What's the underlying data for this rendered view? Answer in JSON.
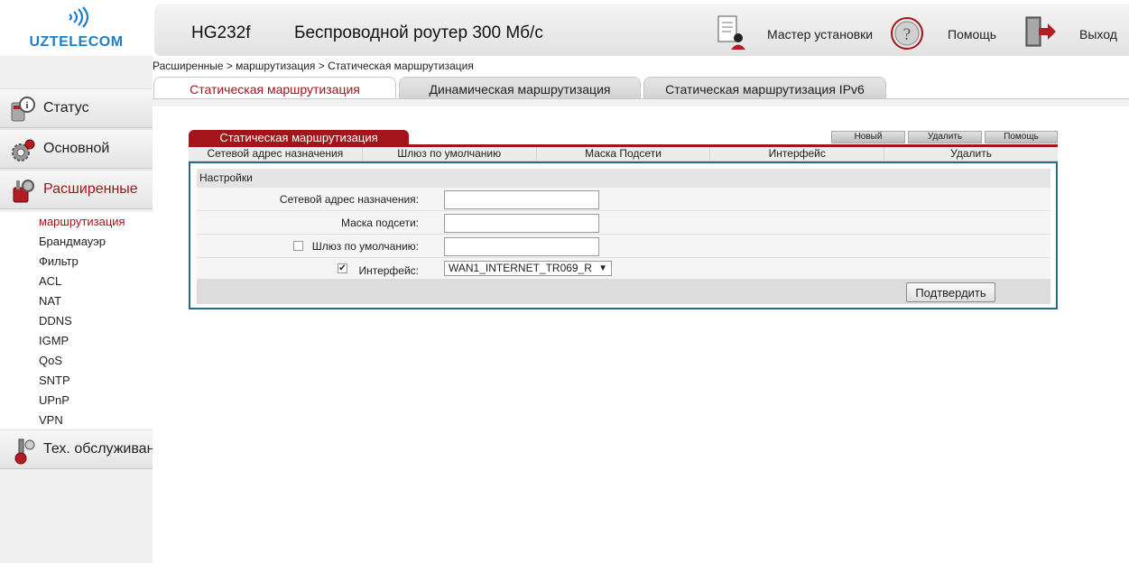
{
  "brand": {
    "logo_text": "UZTELECOM"
  },
  "header": {
    "model": "HG232f",
    "product": "Беспроводной роутер 300 Мб/с",
    "wizard_label": "Мастер установки",
    "help_label": "Помощь",
    "logout_label": "Выход"
  },
  "sidebar": {
    "status_label": "Статус",
    "basic_label": "Основной",
    "advanced_label": "Расширенные",
    "maintenance_label": "Тех. обслуживан",
    "subitems": [
      "маршрутизация",
      "Брандмауэр",
      "Фильтр",
      "ACL",
      "NAT",
      "DDNS",
      "IGMP",
      "QoS",
      "SNTP",
      "UPnP",
      "VPN"
    ]
  },
  "breadcrumb": "Расширенные > маршрутизация > Статическая маршрутизация",
  "tabs": [
    "Статическая маршрутизация",
    "Динамическая маршрутизация",
    "Статическая маршрутизация IPv6"
  ],
  "table": {
    "title": "Статическая маршрутизация",
    "buttons": {
      "new": "Новый",
      "delete": "Удалить",
      "help": "Помощь"
    },
    "columns": [
      "Сетевой адрес назначения",
      "Шлюз по умолчанию",
      "Маска Подсети",
      "Интерфейс",
      "Удалить"
    ]
  },
  "form": {
    "section_title": "Настройки",
    "dest_label": "Сетевой адрес назначения:",
    "dest_value": "",
    "mask_label": "Маска подсети:",
    "mask_value": "",
    "gateway_label": "Шлюз по умолчанию:",
    "gateway_checked": false,
    "gateway_value": "",
    "iface_label": "Интерфейс:",
    "iface_checked": true,
    "iface_value": "WAN1_INTERNET_TR069_R",
    "confirm_label": "Подтвердить"
  },
  "colors": {
    "accent": "#a5141b",
    "brand": "#1d7fc6",
    "frame": "#2a6a82"
  }
}
